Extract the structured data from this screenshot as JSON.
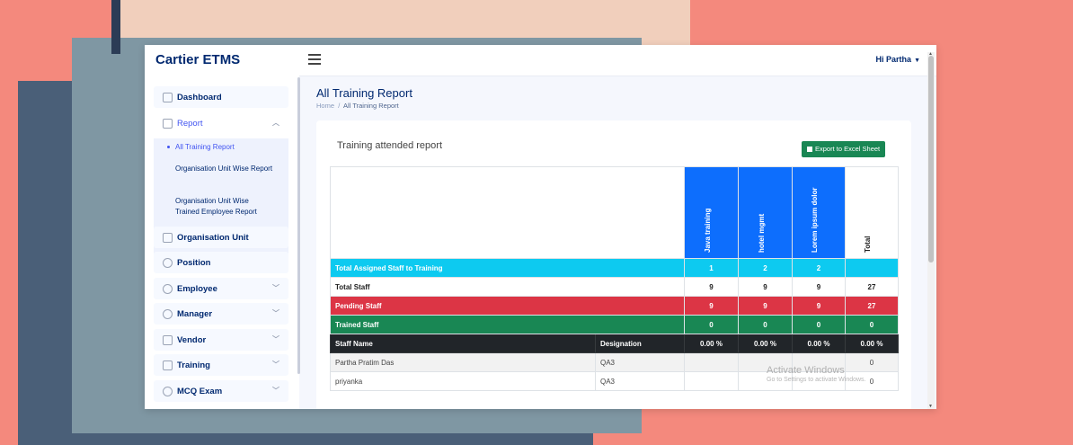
{
  "app": {
    "brand": "Cartier ETMS",
    "user": "Hi Partha"
  },
  "sidebar": {
    "items": [
      {
        "label": "Dashboard"
      },
      {
        "label": "Report"
      },
      {
        "label": "Organisation Unit"
      },
      {
        "label": "Position"
      },
      {
        "label": "Employee"
      },
      {
        "label": "Manager"
      },
      {
        "label": "Vendor"
      },
      {
        "label": "Training"
      },
      {
        "label": "MCQ Exam"
      }
    ],
    "report_sub": [
      {
        "label": "All Training Report"
      },
      {
        "label": "Organisation Unit Wise Report"
      },
      {
        "label": "Organisation Unit Wise Trained Employee Report"
      }
    ]
  },
  "page": {
    "title": "All Training Report",
    "breadcrumb_home": "Home",
    "breadcrumb_sep": "/",
    "breadcrumb_current": "All Training Report"
  },
  "card": {
    "title": "Training attended report",
    "export_label": "Export to Excel Sheet"
  },
  "table": {
    "trainings": [
      "Java training",
      "hotel mgmt",
      "Lorem ipsum dolor"
    ],
    "total_label": "Total",
    "rows": [
      {
        "label": "Total Assigned Staff to Training",
        "values": [
          "1",
          "2",
          "2",
          ""
        ]
      },
      {
        "label": "Total Staff",
        "values": [
          "9",
          "9",
          "9",
          "27"
        ]
      },
      {
        "label": "Pending Staff",
        "values": [
          "9",
          "9",
          "9",
          "27"
        ]
      },
      {
        "label": "Trained Staff",
        "values": [
          "0",
          "0",
          "0",
          "0"
        ]
      }
    ],
    "staff_header": {
      "name": "Staff Name",
      "designation": "Designation",
      "values": [
        "0.00 %",
        "0.00 %",
        "0.00 %",
        "0.00 %"
      ]
    },
    "staff": [
      {
        "name": "Partha Pratim Das",
        "designation": "QA3",
        "values": [
          "",
          "",
          "",
          "0"
        ]
      },
      {
        "name": "priyanka",
        "designation": "QA3",
        "values": [
          "",
          "",
          "",
          "0"
        ]
      }
    ]
  },
  "watermark": {
    "line1": "Activate Windows",
    "line2": "Go to Settings to activate Windows."
  },
  "colors": {
    "primary": "#0d6efd",
    "cyan": "#0dcaf0",
    "danger": "#dc3545",
    "success": "#198754",
    "dark": "#212529",
    "brand": "#012970"
  }
}
